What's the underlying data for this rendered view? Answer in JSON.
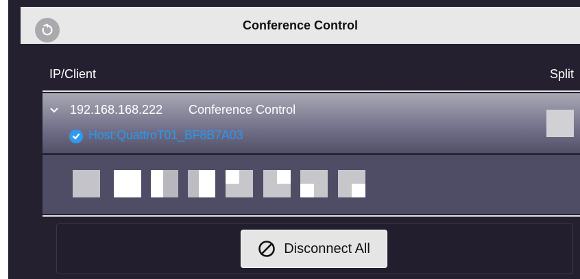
{
  "header": {
    "title": "Conference Control",
    "back_icon": "back-arrow-icon"
  },
  "columns": {
    "ip_client": "IP/Client",
    "split": "Split"
  },
  "session": {
    "ip": "192.168.168.222",
    "name": "Conference Control",
    "host": "Host:QuattroT01_BF8B7A03",
    "host_color": "#2b97ef",
    "expanded": true,
    "split_checked": false
  },
  "layouts": [
    {
      "name": "gray-full"
    },
    {
      "name": "white-full"
    },
    {
      "name": "split-vertical"
    },
    {
      "name": "split-vertical-alt"
    },
    {
      "name": "quad-top"
    },
    {
      "name": "quad-top-right"
    },
    {
      "name": "two-by-two"
    },
    {
      "name": "bottom-right"
    }
  ],
  "footer": {
    "disconnect_label": "Disconnect All"
  }
}
